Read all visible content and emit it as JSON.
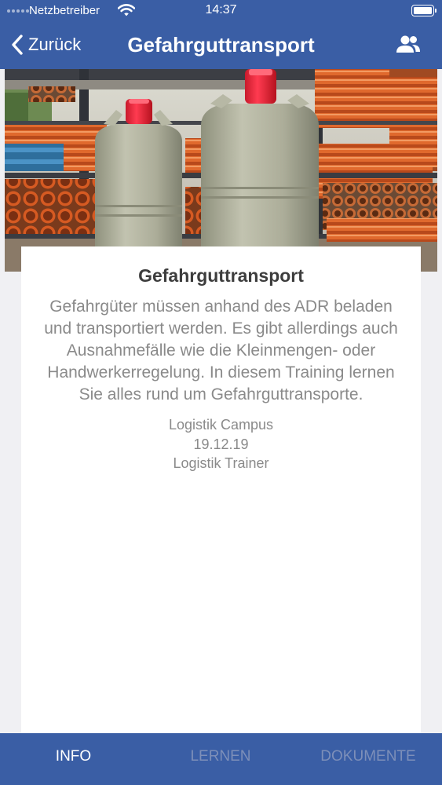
{
  "status_bar": {
    "carrier": "Netzbetreiber",
    "time": "14:37",
    "battery_level": 1.0
  },
  "nav": {
    "back_label": "Zurück",
    "title": "Gefahrguttransport",
    "back_icon": "chevron-left-icon",
    "right_icon": "people-icon"
  },
  "hero": {
    "icon": "gas-cylinders-photo"
  },
  "card": {
    "title": "Gefahrguttransport",
    "description": "Gefahrgüter müssen anhand des ADR beladen und transportiert werden. Es gibt allerdings auch Ausnahmefälle wie die Kleinmengen- oder Handwerkerregelung. In diesem Training lernen Sie alles rund um Gefahrguttransporte.",
    "organization": "Logistik Campus",
    "date": "19.12.19",
    "trainer": "Logistik Trainer"
  },
  "tabs": [
    {
      "label": "INFO",
      "active": true
    },
    {
      "label": "LERNEN",
      "active": false
    },
    {
      "label": "DOKUMENTE",
      "active": false
    }
  ],
  "colors": {
    "brand": "#3a5ea5",
    "tab_inactive": "#7d8fb9",
    "text_secondary": "#8a8a8a"
  }
}
